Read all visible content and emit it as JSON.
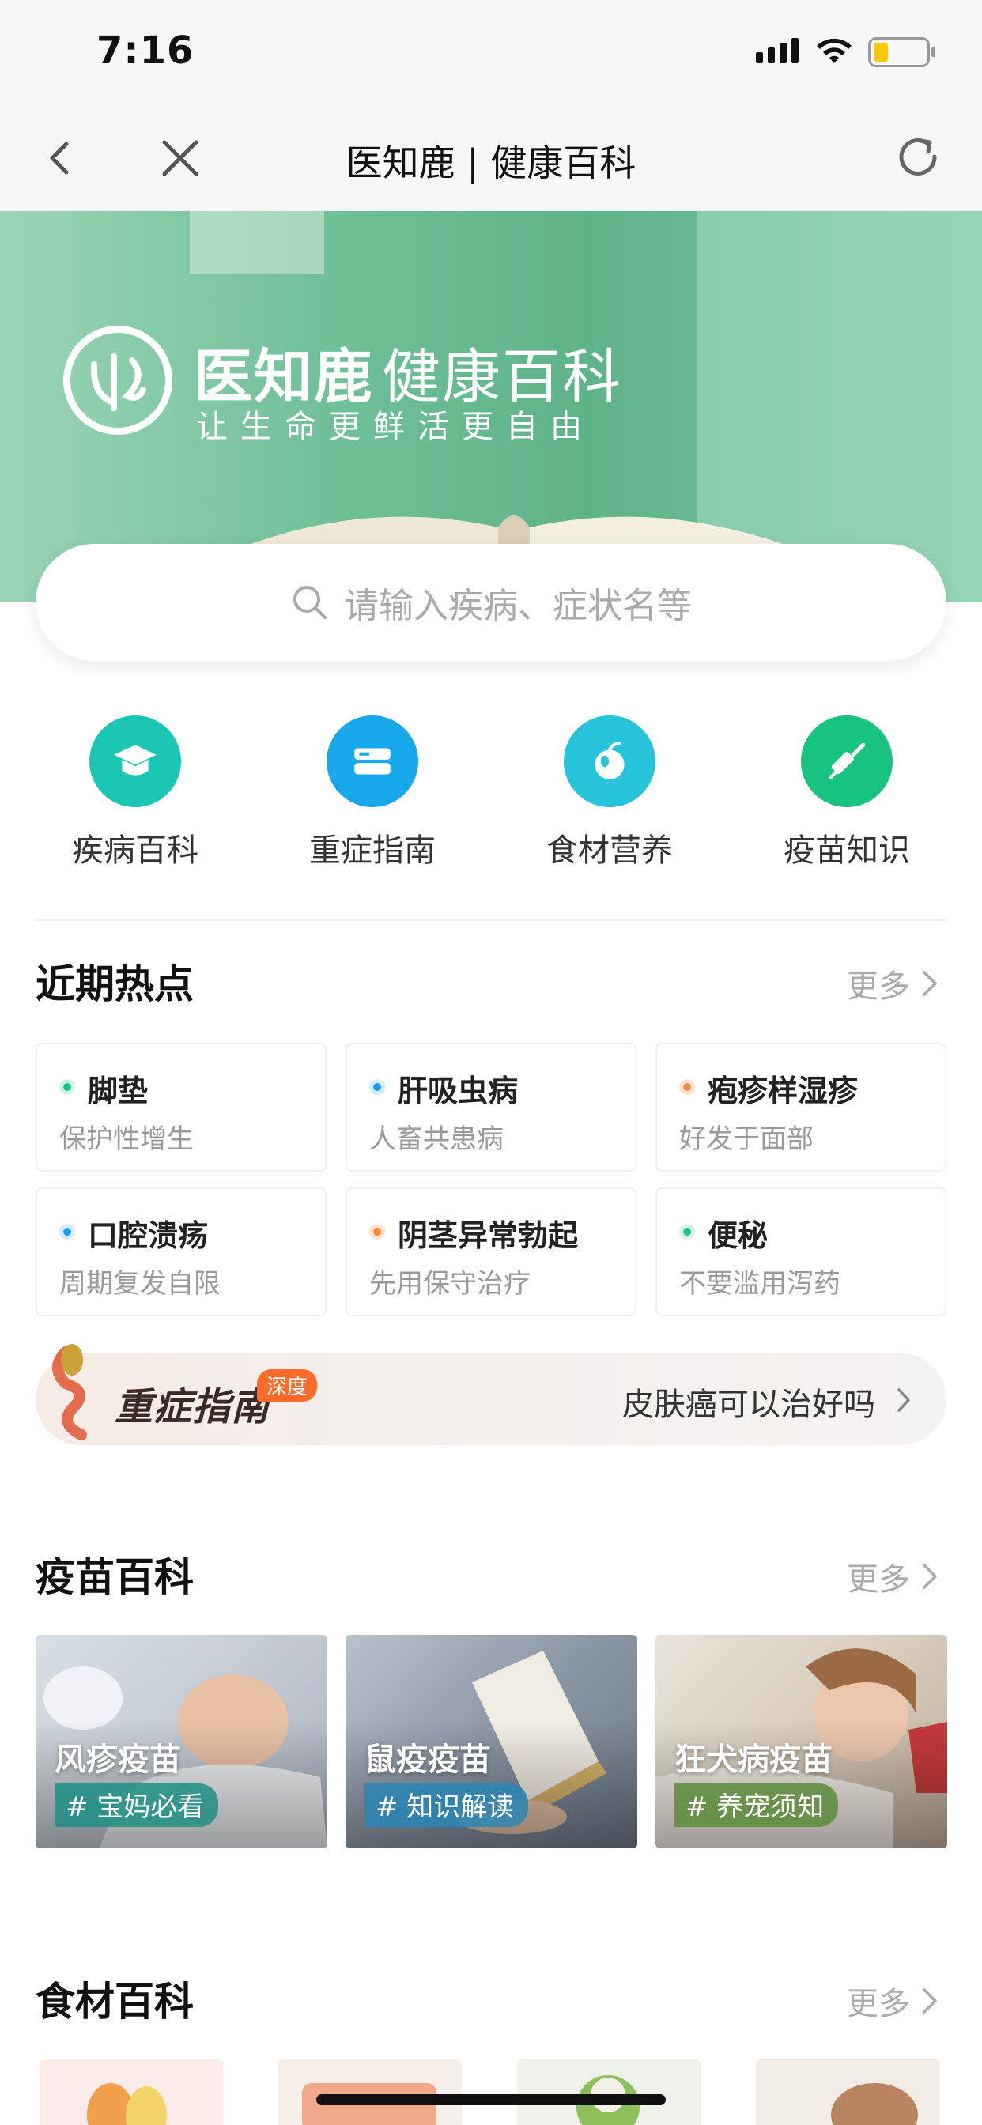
{
  "status": {
    "time": "7:16"
  },
  "nav": {
    "title": "医知鹿 | 健康百科"
  },
  "banner": {
    "brand": "医知鹿",
    "brand_sub": "健康百科",
    "slogan": "让生命更鲜活更自由"
  },
  "search": {
    "placeholder": "请输入疾病、症状名等"
  },
  "categories": [
    {
      "label": "疾病百科",
      "icon": "graduation-cap-icon",
      "color": "#1bc7b4"
    },
    {
      "label": "重症指南",
      "icon": "book-stack-icon",
      "color": "#18a7e8"
    },
    {
      "label": "食材营养",
      "icon": "apple-icon",
      "color": "#27c3da"
    },
    {
      "label": "疫苗知识",
      "icon": "syringe-icon",
      "color": "#18c27f"
    }
  ],
  "hot": {
    "title": "近期热点",
    "more": "更多",
    "items": [
      {
        "name": "脚垫",
        "desc": "保护性增生",
        "dot": "green"
      },
      {
        "name": "肝吸虫病",
        "desc": "人畜共患病",
        "dot": "blue"
      },
      {
        "name": "疱疹样湿疹",
        "desc": "好发于面部",
        "dot": "orange"
      },
      {
        "name": "口腔溃疡",
        "desc": "周期复发自限",
        "dot": "blue"
      },
      {
        "name": "阴茎异常勃起",
        "desc": "先用保守治疗",
        "dot": "orange"
      },
      {
        "name": "便秘",
        "desc": "不要滥用泻药",
        "dot": "green"
      }
    ]
  },
  "guide": {
    "title": "重症指南",
    "badge": "深度",
    "question": "皮肤癌可以治好吗"
  },
  "vaccine": {
    "title": "疫苗百科",
    "more": "更多",
    "cards": [
      {
        "name": "风疹疫苗",
        "tag": "# 宝妈必看",
        "tag_color": "#1f8f84"
      },
      {
        "name": "鼠疫疫苗",
        "tag": "# 知识解读",
        "tag_color": "#2a86b6"
      },
      {
        "name": "狂犬病疫苗",
        "tag": "# 养宠须知",
        "tag_color": "#5a8b3a"
      }
    ]
  },
  "food": {
    "title": "食材百科",
    "more": "更多"
  }
}
